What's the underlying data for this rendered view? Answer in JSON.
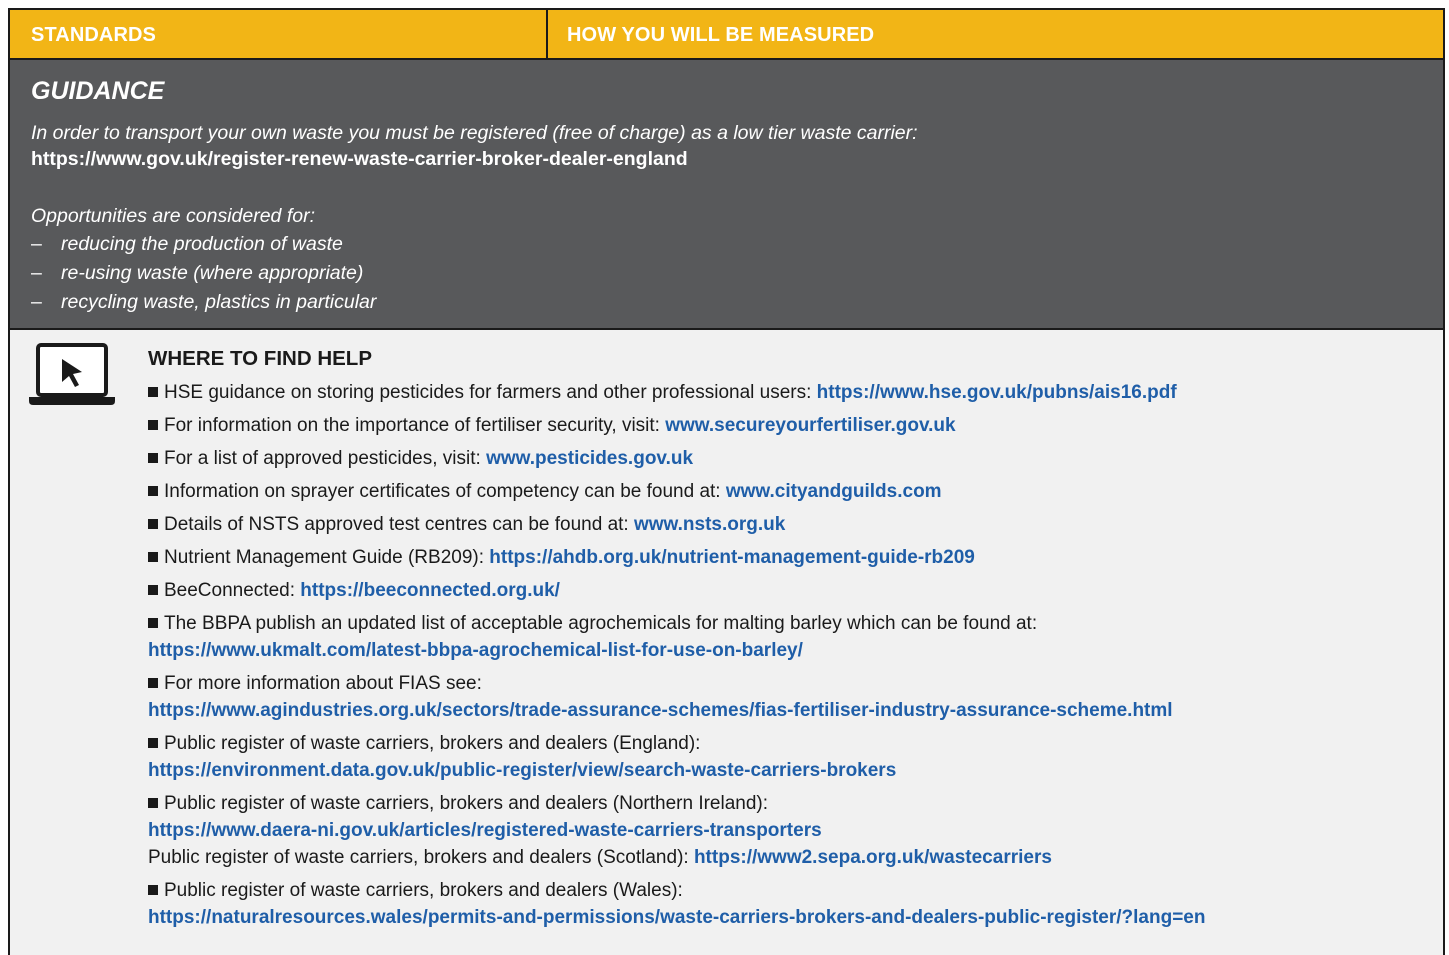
{
  "header": {
    "standards_label": "STANDARDS",
    "measured_label": "HOW YOU WILL BE MEASURED"
  },
  "guidance": {
    "title": "GUIDANCE",
    "intro": "In order to transport your own waste you must be registered (free of charge) as a low tier waste carrier:",
    "link": "https://www.gov.uk/register-renew-waste-carrier-broker-dealer-england",
    "opportunities_label": "Opportunities are considered for:",
    "bullets": [
      "reducing the production of waste",
      "re-using waste (where appropriate)",
      "recycling waste, plastics in particular"
    ],
    "dash": "–"
  },
  "help": {
    "icon": "laptop-cursor-icon",
    "title": "WHERE TO FIND HELP",
    "items": [
      {
        "text": "HSE guidance on storing pesticides for farmers and other professional users: ",
        "link": "https://www.hse.gov.uk/pubns/ais16.pdf"
      },
      {
        "text": "For information on the importance of fertiliser security, visit: ",
        "link": "www.secureyourfertiliser.gov.uk"
      },
      {
        "text": "For a list of approved pesticides, visit: ",
        "link": "www.pesticides.gov.uk"
      },
      {
        "text": "Information on sprayer certificates of competency can be found at: ",
        "link": "www.cityandguilds.com"
      },
      {
        "text": "Details of NSTS approved test centres can be found at: ",
        "link": "www.nsts.org.uk"
      },
      {
        "text": "Nutrient Management Guide (RB209): ",
        "link": "https://ahdb.org.uk/nutrient-management-guide-rb209"
      },
      {
        "text": "BeeConnected: ",
        "link": "https://beeconnected.org.uk/"
      },
      {
        "text": "The BBPA publish an updated list of acceptable agrochemicals for malting barley which can be found at:",
        "link": "https://www.ukmalt.com/latest-bbpa-agrochemical-list-for-use-on-barley/"
      },
      {
        "text": "For more information about FIAS see:",
        "link": "https://www.agindustries.org.uk/sectors/trade-assurance-schemes/fias-fertiliser-industry-assurance-scheme.html"
      },
      {
        "text": "Public register of waste carriers, brokers and dealers (England):",
        "link": "https://environment.data.gov.uk/public-register/view/search-waste-carriers-brokers"
      },
      {
        "text": "Public register of waste carriers, brokers and dealers (Northern Ireland):",
        "link": "https://www.daera-ni.gov.uk/articles/registered-waste-carriers-transporters",
        "extra_text": "Public register of waste carriers, brokers and dealers (Scotland): ",
        "extra_link": "https://www2.sepa.org.uk/wastecarriers"
      },
      {
        "text": "Public register of waste carriers, brokers and dealers (Wales):",
        "link": "https://naturalresources.wales/permits-and-permissions/waste-carriers-brokers-and-dealers-public-register/?lang=en"
      }
    ]
  }
}
